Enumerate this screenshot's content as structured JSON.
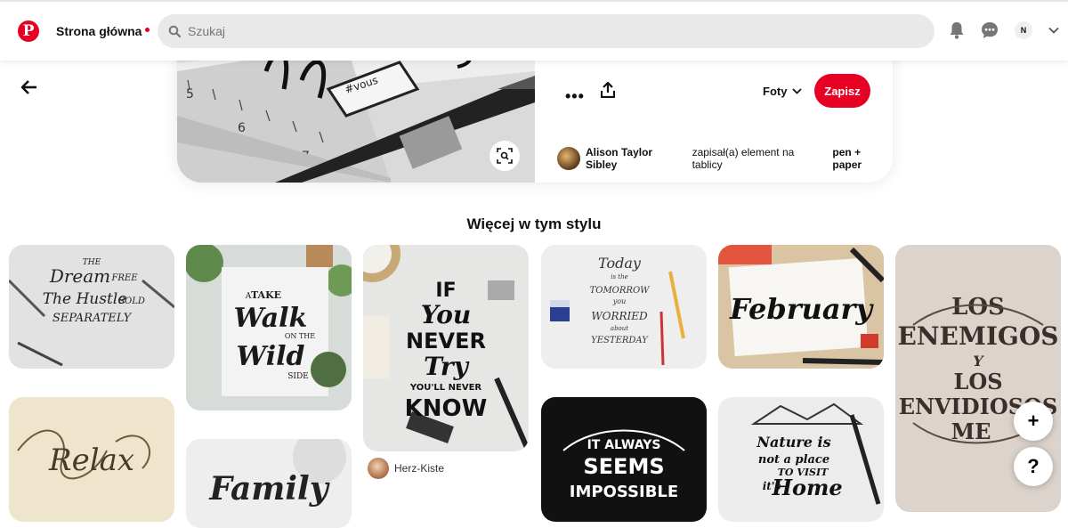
{
  "header": {
    "logo_letter": "P",
    "home_label": "Strona główna",
    "search_placeholder": "Szukaj",
    "avatar_initial": "N"
  },
  "pin": {
    "board_label": "Foty",
    "save_label": "Zapisz",
    "more_label": "•••",
    "saver_name": "Alison Taylor Sibley",
    "saver_action": "zapisał(a) element na tablicy",
    "board_name": "pen + paper"
  },
  "more_section": {
    "title": "Więcej w tym stylu",
    "pins": [
      {
        "lettering": [
          "THE",
          "Dream",
          "FREE",
          "The Hustle",
          "SOLD",
          "SEPARATELY"
        ]
      },
      {
        "lettering": [
          "TAKE",
          "A",
          "Walk",
          "ON THE",
          "Wild",
          "SIDE"
        ]
      },
      {
        "lettering": [
          "IF",
          "You",
          "NEVER",
          "Try",
          "YOU'LL NEVER",
          "KNOW"
        ],
        "owner": "Herz-Kiste"
      },
      {
        "lettering": [
          "Today",
          "is the",
          "TOMORROW",
          "you",
          "WORRIED",
          "about",
          "YESTERDAY"
        ]
      },
      {
        "lettering": [
          "February"
        ]
      },
      {
        "lettering": [
          "LOS",
          "ENEMIGOS",
          "Y",
          "LOS",
          "ENVIDIOSOS",
          "ME"
        ]
      },
      {
        "lettering": [
          "Relax"
        ]
      },
      {
        "lettering": [
          "Family"
        ]
      },
      {
        "lettering": [
          "IT ALWAYS",
          "SEEMS",
          "IMPOSSIBLE"
        ]
      },
      {
        "lettering": [
          "Nature is",
          "not a place",
          "TO VISIT",
          "it's",
          "Home"
        ]
      }
    ]
  },
  "fab": {
    "add_label": "+",
    "help_label": "?"
  },
  "colors": {
    "brand": "#e60023"
  }
}
